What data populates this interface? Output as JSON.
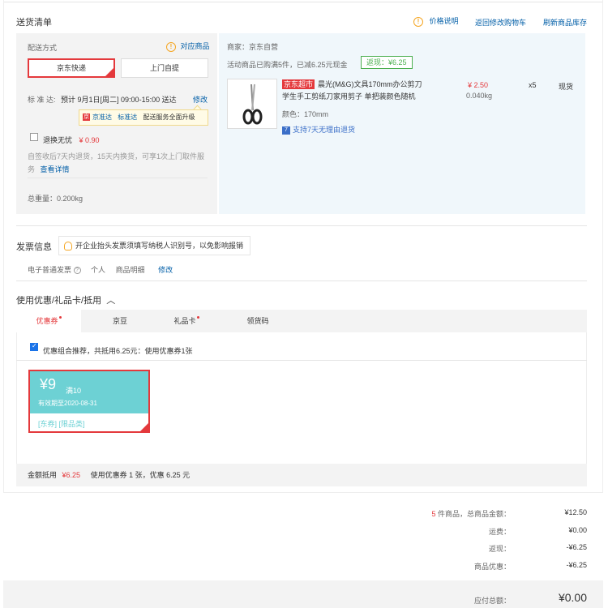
{
  "shipping": {
    "title": "送货清单",
    "links": {
      "price_note": "价格说明",
      "back_to_cart": "返回修改购物车",
      "refresh_stock": "刷新商品库存"
    },
    "method_label": "配送方式",
    "match_goods": "对应商品",
    "options": [
      "京东快递",
      "上门自提"
    ],
    "std_label": "标 准 达:",
    "std_time": "预计 9月1日[周二] 09:00-15:00 送达",
    "modify": "修改",
    "tip_brand": "京准达",
    "tip_std": "标准达",
    "tip_text": "配送服务全面升级",
    "worry_free_label": "退换无忧",
    "worry_free_price": "¥ 0.90",
    "worry_free_desc_1": "自签收后7天内退货，15天内换货，可享1次上门取件服",
    "worry_free_desc_2": "务",
    "view_detail": "查看详情",
    "total_weight": "总重量：0.200kg"
  },
  "product": {
    "seller": "商家：京东自营",
    "promo": "活动商品已购满5件，已减6.25元现金",
    "rebate": "返现：¥6.25",
    "tag": "京东超市",
    "name_line1": "晨光(M&G)文具170mm办公剪刀",
    "name_line2": "学生手工剪纸刀家用剪子 单把装颜色随机",
    "color": "颜色：170mm",
    "return_policy": "支持7天无理由退货",
    "price": "¥ 2.50",
    "weight": "0.040kg",
    "qty": "x5",
    "stock": "现货"
  },
  "invoice": {
    "title": "发票信息",
    "tip": "开企业抬头发票须填写纳税人识别号，以免影响报销",
    "type": "电子普通发票",
    "person": "个人",
    "detail": "商品明细",
    "modify": "修改"
  },
  "discount": {
    "title": "使用优惠/礼品卡/抵用",
    "tabs": [
      "优惠券",
      "京豆",
      "礼品卡",
      "领货码"
    ],
    "combo": "优惠组合推荐，共抵用6.25元：使用优惠券1张",
    "coupon": {
      "amount": "¥9",
      "cond": "满10",
      "expire": "有效期至2020-08-31",
      "tags": "[东券] [限品类]"
    },
    "summary_label": "金额抵用",
    "summary_amount": "¥6.25",
    "summary_text": "使用优惠券 1 张，优惠 6.25 元"
  },
  "totals": {
    "count": "5",
    "count_label": "件商品，总商品金额：",
    "goods_total": "¥12.50",
    "freight_label": "运费：",
    "freight": "¥0.00",
    "rebate_label": "返现：",
    "rebate": "-¥6.25",
    "discount_label": "商品优惠：",
    "discount": "-¥6.25",
    "payable_label": "应付总额：",
    "payable": "¥0.00"
  }
}
